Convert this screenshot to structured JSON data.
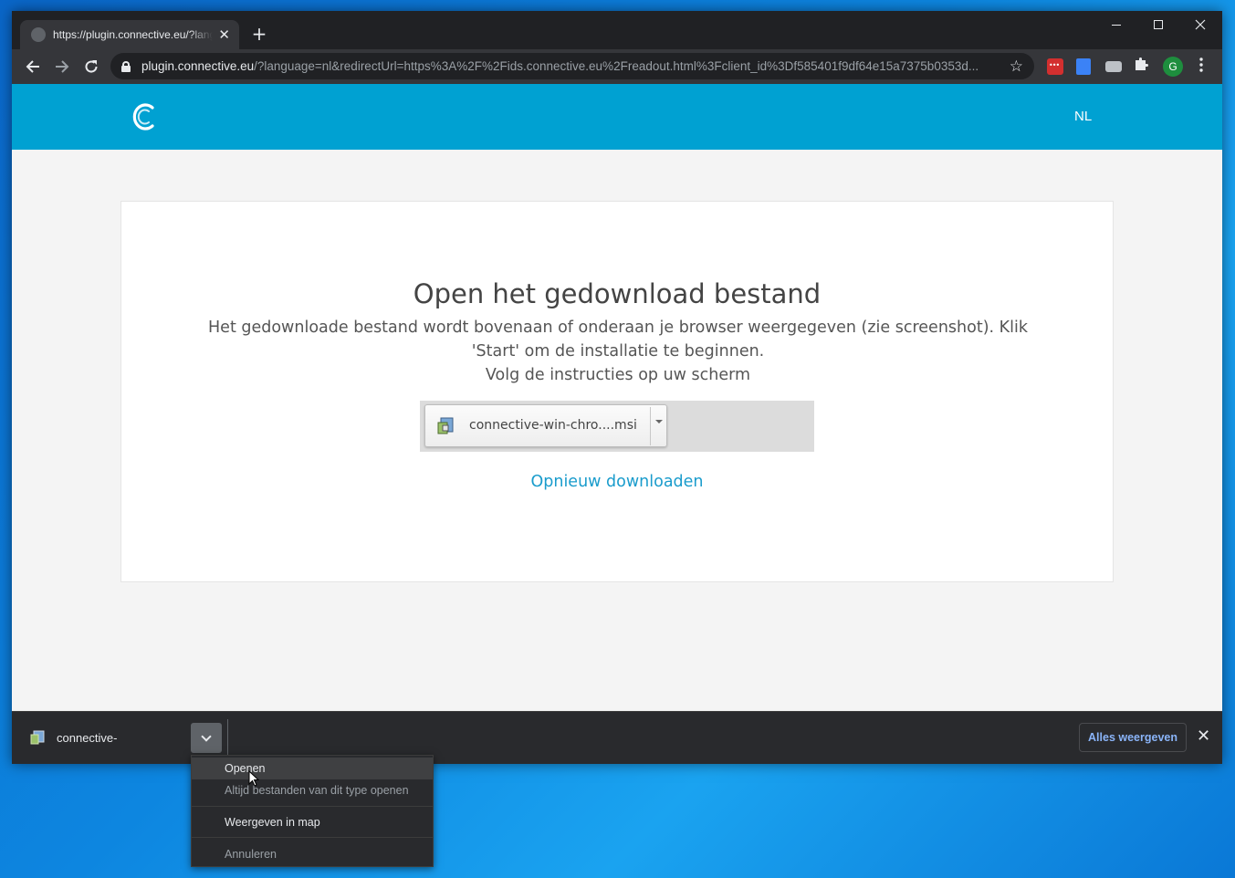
{
  "browser": {
    "tab_title": "https://plugin.connective.eu/?language=nl",
    "tab_close": "✕",
    "new_tab": "+",
    "url_host": "plugin.connective.eu",
    "url_rest": "/?language=nl&redirectUrl=https%3A%2F%2Fids.connective.eu%2Freadout.html%3Fclient_id%3Df585401f9df64e15a7375b0353d...",
    "profile_initial": "G"
  },
  "site": {
    "language": "NL",
    "brand_color": "#00a1d2"
  },
  "card": {
    "title": "Open het gedownload bestand",
    "line1": "Het gedownloade bestand wordt bovenaan of onderaan je browser weergegeven (zie screenshot). Klik 'Start' om de installatie te beginnen.",
    "line2": "Volg de instructies op uw scherm",
    "preview_filename": "connective-win-chro....msi",
    "redownload": "Opnieuw downloaden"
  },
  "shelf": {
    "item_name": "connective-",
    "show_all": "Alles weergeven",
    "close": "✕"
  },
  "context_menu": {
    "open": "Openen",
    "always_open": "Altijd bestanden van dit type openen",
    "show_in_folder": "Weergeven in map",
    "cancel": "Annuleren"
  }
}
